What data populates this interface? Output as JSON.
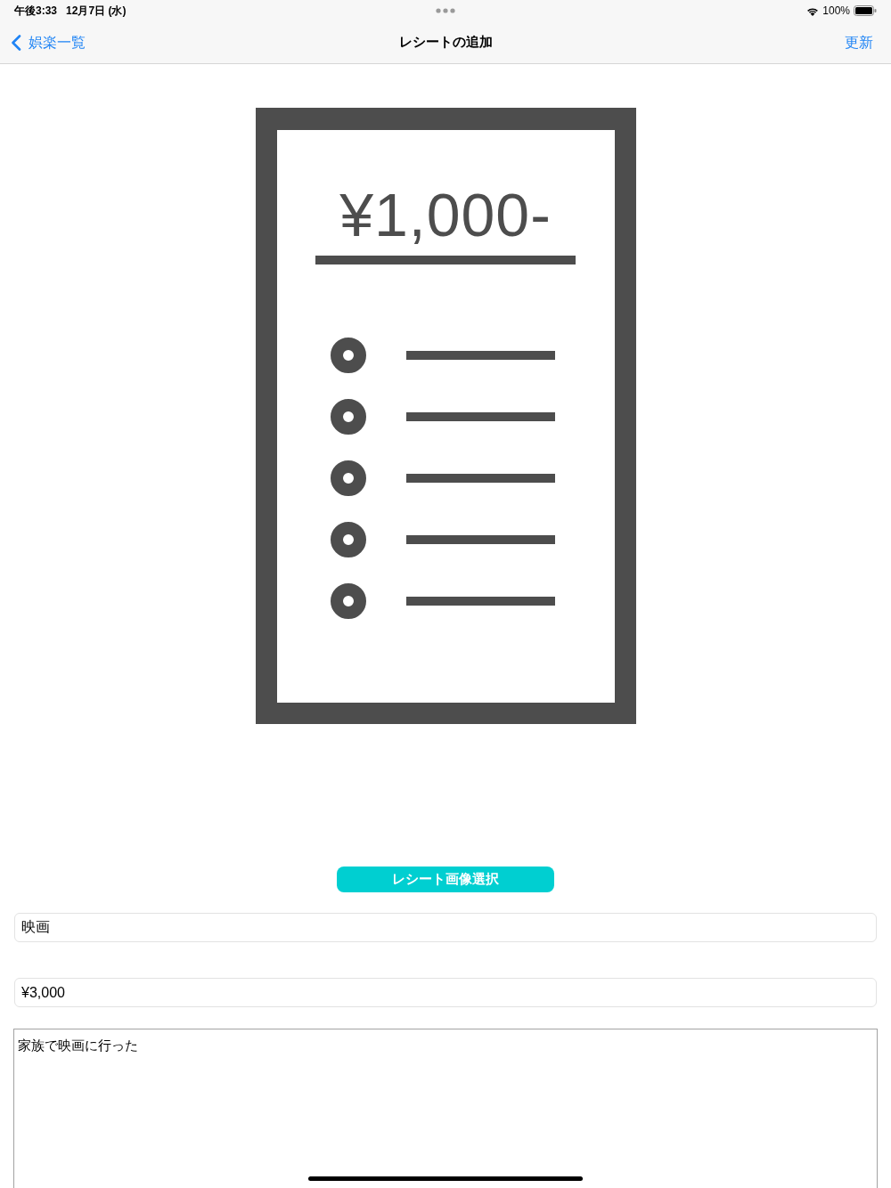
{
  "status_bar": {
    "time": "午後3:33",
    "date": "12月7日 (水)",
    "battery": "100%"
  },
  "nav_bar": {
    "back": "娯楽一覧",
    "title": "レシートの追加",
    "action": "更新"
  },
  "receipt_image": {
    "amount": "¥1,000-"
  },
  "select_button": {
    "label": "レシート画像選択"
  },
  "fields": [
    {
      "kind": "input",
      "value": "映画"
    },
    {
      "kind": "input",
      "value": "¥3,000"
    },
    {
      "kind": "textarea",
      "value": "家族で映画に行った"
    }
  ]
}
